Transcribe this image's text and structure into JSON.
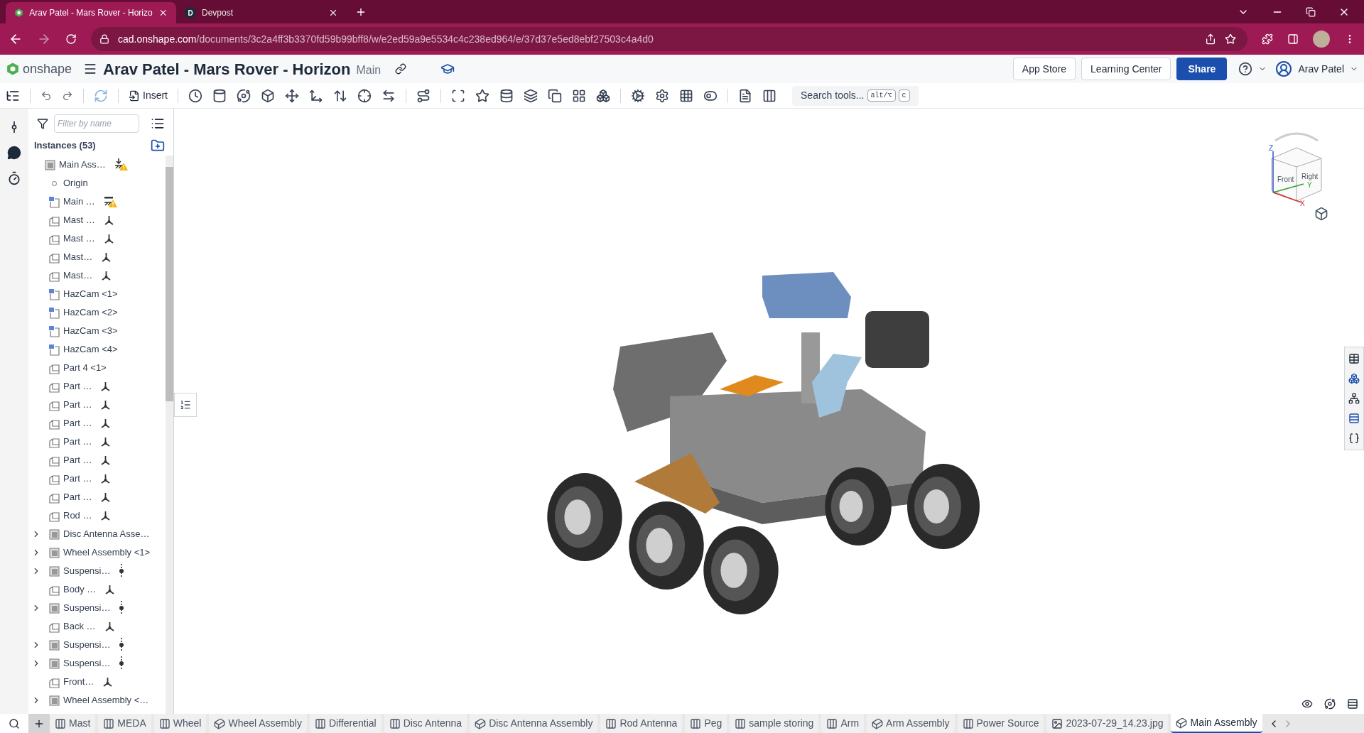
{
  "browser": {
    "tabs": [
      {
        "title": "Arav Patel - Mars Rover - Horizo",
        "kind": "onshape",
        "selected": true
      },
      {
        "title": "Devpost",
        "kind": "letter",
        "letter": "D",
        "selected": false
      }
    ],
    "url_host": "cad.onshape.com",
    "url_path": "/documents/3c2a4ff3b3370fd59b99bff8/w/e2ed59a9e5534c4c238ed964/e/37d37e5ed8ebf27503c4a4d0"
  },
  "app": {
    "logo": "onshape",
    "title": "Arav Patel - Mars Rover - Horizon",
    "branch": "Main",
    "buttons": [
      "App Store",
      "Learning Center"
    ],
    "share": "Share",
    "user": "Arav Patel"
  },
  "toolbar": {
    "insert": "Insert",
    "search": "Search tools...",
    "shortcut_keys": [
      "alt/⌥",
      "c"
    ]
  },
  "panel": {
    "filter_placeholder": "Filter by name",
    "heading": "Instances (53)",
    "items": [
      {
        "label": "Main Ass…",
        "kind": "root",
        "badge": {
          "kind": "fixed-warning"
        }
      },
      {
        "label": "Origin",
        "kind": "origin"
      },
      {
        "label": "Main …",
        "kind": "part-studio",
        "badge": {
          "kind": "shaded-warning"
        }
      },
      {
        "label": "Mast …",
        "kind": "part",
        "badge": {
          "kind": "triad"
        }
      },
      {
        "label": "Mast …",
        "kind": "part",
        "badge": {
          "kind": "triad"
        }
      },
      {
        "label": "Mast…",
        "kind": "part",
        "badge": {
          "kind": "triad"
        }
      },
      {
        "label": "Mast…",
        "kind": "part",
        "badge": {
          "kind": "triad"
        }
      },
      {
        "label": "HazCam <1>",
        "kind": "part-studio"
      },
      {
        "label": "HazCam <2>",
        "kind": "part-studio"
      },
      {
        "label": "HazCam <3>",
        "kind": "part-studio"
      },
      {
        "label": "HazCam <4>",
        "kind": "part-studio"
      },
      {
        "label": "Part 4 <1>",
        "kind": "part"
      },
      {
        "label": "Part …",
        "kind": "part",
        "badge": {
          "kind": "triad"
        }
      },
      {
        "label": "Part …",
        "kind": "part",
        "badge": {
          "kind": "triad"
        }
      },
      {
        "label": "Part …",
        "kind": "part",
        "badge": {
          "kind": "triad"
        }
      },
      {
        "label": "Part …",
        "kind": "part",
        "badge": {
          "kind": "triad"
        }
      },
      {
        "label": "Part …",
        "kind": "part",
        "badge": {
          "kind": "triad"
        }
      },
      {
        "label": "Part …",
        "kind": "part",
        "badge": {
          "kind": "triad"
        }
      },
      {
        "label": "Part …",
        "kind": "part",
        "badge": {
          "kind": "triad"
        }
      },
      {
        "label": "Rod …",
        "kind": "part",
        "badge": {
          "kind": "triad"
        }
      },
      {
        "label": "Disc Antenna Asse…",
        "kind": "assembly",
        "expanded": false
      },
      {
        "label": "Wheel Assembly <1>",
        "kind": "assembly",
        "expanded": false
      },
      {
        "label": "Suspensi…",
        "kind": "assembly",
        "expanded": false,
        "badge": {
          "kind": "slider"
        }
      },
      {
        "label": "Body …",
        "kind": "part",
        "badge": {
          "kind": "triad"
        }
      },
      {
        "label": "Suspensi…",
        "kind": "assembly",
        "expanded": false,
        "badge": {
          "kind": "slider"
        }
      },
      {
        "label": "Back …",
        "kind": "part",
        "badge": {
          "kind": "triad"
        }
      },
      {
        "label": "Suspensi…",
        "kind": "assembly",
        "expanded": false,
        "badge": {
          "kind": "slider"
        }
      },
      {
        "label": "Suspensi…",
        "kind": "assembly",
        "expanded": false,
        "badge": {
          "kind": "slider"
        }
      },
      {
        "label": "Front…",
        "kind": "part",
        "badge": {
          "kind": "triad"
        }
      },
      {
        "label": "Wheel Assembly <…",
        "kind": "assembly",
        "expanded": false
      }
    ]
  },
  "view_cube": {
    "faces": [
      "Front",
      "Right"
    ],
    "axes": [
      "Z",
      "Y",
      "X"
    ]
  },
  "document_tabs": [
    {
      "label": "Mast",
      "kind": "part-studio",
      "selected": false
    },
    {
      "label": "MEDA",
      "kind": "part-studio",
      "selected": false
    },
    {
      "label": "Wheel",
      "kind": "part-studio",
      "selected": false
    },
    {
      "label": "Wheel Assembly",
      "kind": "assembly",
      "selected": false
    },
    {
      "label": "Differential",
      "kind": "part-studio",
      "selected": false
    },
    {
      "label": "Disc Antenna",
      "kind": "part-studio",
      "selected": false
    },
    {
      "label": "Disc Antenna Assembly",
      "kind": "assembly",
      "selected": false
    },
    {
      "label": "Rod Antenna",
      "kind": "part-studio",
      "selected": false
    },
    {
      "label": "Peg",
      "kind": "part-studio",
      "selected": false
    },
    {
      "label": "sample storing",
      "kind": "part-studio",
      "selected": false
    },
    {
      "label": "Arm",
      "kind": "part-studio",
      "selected": false
    },
    {
      "label": "Arm Assembly",
      "kind": "assembly",
      "selected": false
    },
    {
      "label": "Power Source",
      "kind": "part-studio",
      "selected": false
    },
    {
      "label": "2023-07-29_14.23.jpg",
      "kind": "image",
      "selected": false
    },
    {
      "label": "Main Assembly",
      "kind": "assembly",
      "selected": true
    }
  ]
}
